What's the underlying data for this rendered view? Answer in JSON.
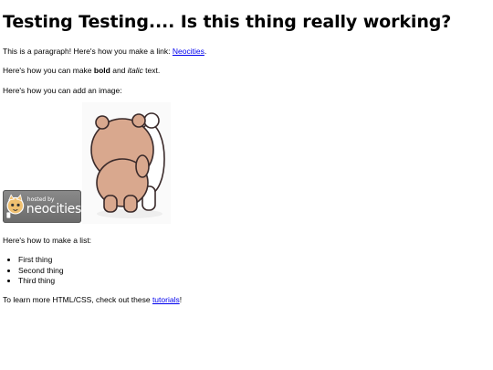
{
  "heading": "Testing Testing.... Is this thing really working?",
  "para_link": {
    "before": "This is a paragraph! Here's how you make a link: ",
    "link": "Neocities",
    "after": "."
  },
  "para_format": {
    "before": "Here's how you can make ",
    "bold": "bold",
    "middle": " and ",
    "italic": "italic",
    "after": " text."
  },
  "para_image": "Here's how you can add an image:",
  "badge": {
    "line1": "hosted by",
    "line2": "neocities"
  },
  "list_intro": "Here's how to make a list:",
  "list_items": [
    "First thing",
    "Second thing",
    "Third thing"
  ],
  "para_learn": {
    "before": "To learn more HTML/CSS, check out these ",
    "link": "tutorials",
    "after": "!"
  },
  "colors": {
    "link": "#0000ee",
    "bear": "#d9a88e",
    "badge": "#7a7a7a"
  }
}
